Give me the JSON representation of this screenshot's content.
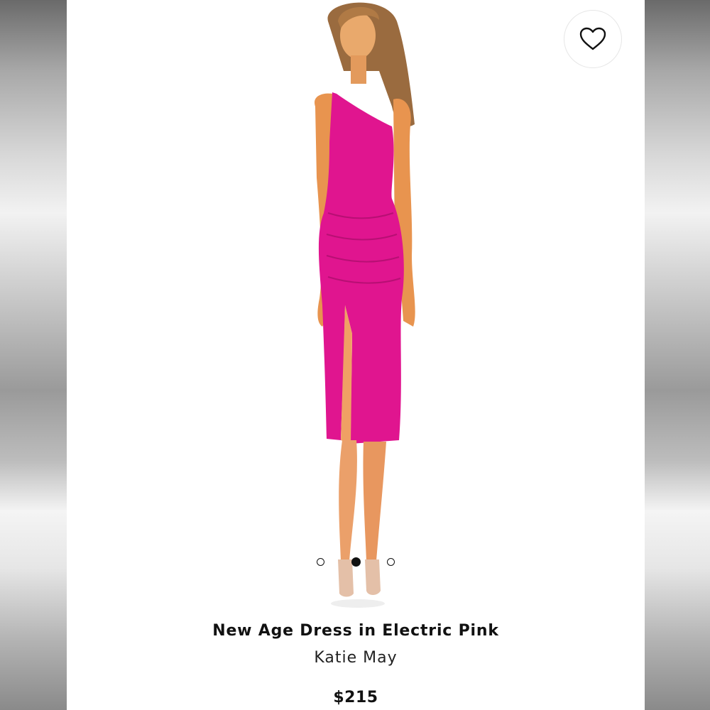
{
  "product": {
    "name": "New Age Dress in Electric Pink",
    "brand": "Katie May",
    "price": "$215",
    "dress_color": "#e0158f"
  },
  "favorite": {
    "icon": "heart-outline-icon"
  },
  "carousel": {
    "total_slides": 3,
    "active_index": 1
  }
}
